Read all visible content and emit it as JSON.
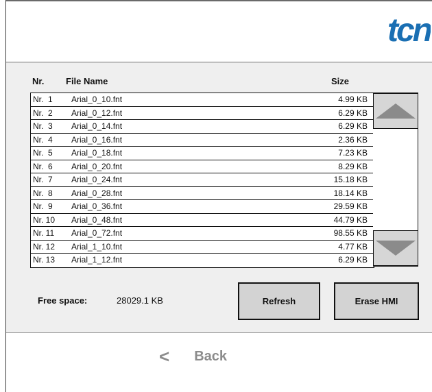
{
  "logo": {
    "text": "tcn"
  },
  "columns": {
    "nr": "Nr.",
    "file_name": "File Name",
    "size": "Size"
  },
  "files": [
    {
      "nr": "Nr.  1",
      "name": "Arial_0_10.fnt",
      "size": "4.99 KB"
    },
    {
      "nr": "Nr.  2",
      "name": "Arial_0_12.fnt",
      "size": "6.29 KB"
    },
    {
      "nr": "Nr.  3",
      "name": "Arial_0_14.fnt",
      "size": "6.29 KB"
    },
    {
      "nr": "Nr.  4",
      "name": "Arial_0_16.fnt",
      "size": "2.36 KB"
    },
    {
      "nr": "Nr.  5",
      "name": "Arial_0_18.fnt",
      "size": "7.23 KB"
    },
    {
      "nr": "Nr.  6",
      "name": "Arial_0_20.fnt",
      "size": "8.29 KB"
    },
    {
      "nr": "Nr.  7",
      "name": "Arial_0_24.fnt",
      "size": "15.18 KB"
    },
    {
      "nr": "Nr.  8",
      "name": "Arial_0_28.fnt",
      "size": "18.14 KB"
    },
    {
      "nr": "Nr.  9",
      "name": "Arial_0_36.fnt",
      "size": "29.59 KB"
    },
    {
      "nr": "Nr. 10",
      "name": "Arial_0_48.fnt",
      "size": "44.79 KB"
    },
    {
      "nr": "Nr. 11",
      "name": "Arial_0_72.fnt",
      "size": "98.55 KB"
    },
    {
      "nr": "Nr. 12",
      "name": "Arial_1_10.fnt",
      "size": "4.77 KB"
    },
    {
      "nr": "Nr. 13",
      "name": "Arial_1_12.fnt",
      "size": "6.29 KB"
    }
  ],
  "scroll": {
    "up_icon": "triangle-up",
    "down_icon": "triangle-down"
  },
  "free_space": {
    "label": "Free space:",
    "value": "28029.1 KB"
  },
  "buttons": {
    "refresh": "Refresh",
    "erase": "Erase HMI"
  },
  "nav": {
    "back_icon": "chevron-left",
    "back_label": "Back"
  },
  "colors": {
    "logo": "#1a6fb3",
    "panel": "#efefef",
    "button": "#d3d3d3",
    "arrow": "#8b8b8b"
  }
}
